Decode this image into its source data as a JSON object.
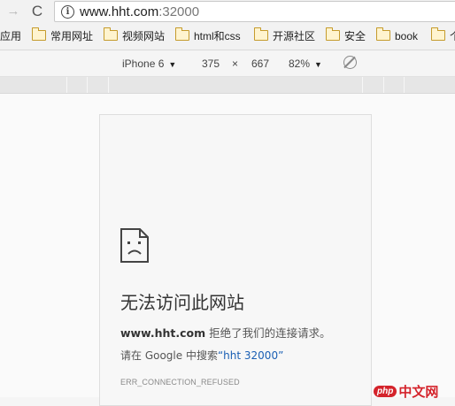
{
  "browser": {
    "url_host": "www.hht.com",
    "url_port": ":32000",
    "forward_icon": "arrow-right",
    "reload_icon": "reload",
    "info_icon": "info-circle"
  },
  "bookmarks": [
    {
      "label": "应用",
      "folder": false
    },
    {
      "label": "常用网址",
      "folder": true
    },
    {
      "label": "视频网站",
      "folder": true
    },
    {
      "label": "html和css",
      "folder": true
    },
    {
      "label": "开源社区",
      "folder": true
    },
    {
      "label": "安全",
      "folder": true
    },
    {
      "label": "book",
      "folder": true
    },
    {
      "label": "个",
      "folder": true
    }
  ],
  "device_toolbar": {
    "device": "iPhone 6",
    "width": "375",
    "times": "×",
    "height": "667",
    "zoom": "82%",
    "rotate_icon": "rotate"
  },
  "error_page": {
    "icon": "sad-document-icon",
    "title": "无法访问此网站",
    "host": "www.hht.com",
    "message": " 拒绝了我们的连接请求。",
    "search_prefix": "请在 Google 中搜索",
    "search_link": "“hht 32000”",
    "code": "ERR_CONNECTION_REFUSED"
  },
  "watermark": {
    "badge": "php",
    "text": "中文网"
  },
  "colors": {
    "link": "#1a5fb4",
    "watermark": "#d4232b",
    "folder": "#c59b2c"
  }
}
